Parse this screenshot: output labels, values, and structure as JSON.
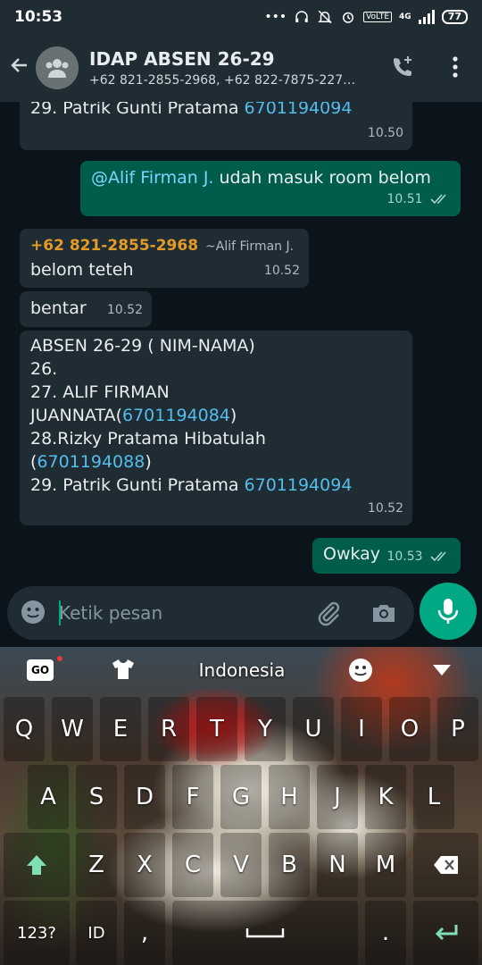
{
  "status_bar": {
    "time": "10:53",
    "network": "4G",
    "battery": "77"
  },
  "header": {
    "title": "IDAP ABSEN 26-29",
    "subtitle": "+62 821-2855-2968, +62 822-7875-227…"
  },
  "messages": {
    "m1": {
      "text_prefix": "29. Patrik Gunti Pratama ",
      "number": "6701194094",
      "time": "10.50"
    },
    "m2": {
      "mention": "@Alif Firman J.",
      "text": " udah masuk room belom",
      "time": "10.51"
    },
    "m3": {
      "sender": "+62 821-2855-2968",
      "sender_alias": "~Alif Firman J.",
      "text": "belom teteh",
      "time": "10.52"
    },
    "m4": {
      "text": "bentar",
      "time": "10.52"
    },
    "m5": {
      "line1": "ABSEN 26-29 ( NIM-NAMA)",
      "line2": "26.",
      "line3": "27. ALIF FIRMAN",
      "line4_prefix": "JUANNATA(",
      "line4_number": "6701194084",
      "line4_suffix": ")",
      "line5": "28.Rizky Pratama Hibatulah",
      "line6_prefix": "(",
      "line6_number": "6701194088",
      "line6_suffix": ")",
      "line7_prefix": "29. Patrik Gunti Pratama ",
      "line7_number": "6701194094",
      "time": "10.52"
    },
    "m6": {
      "text": "Owkay",
      "time": "10.53"
    }
  },
  "input": {
    "placeholder": "Ketik pesan"
  },
  "keyboard": {
    "go_label": "GO",
    "language": "Indonesia",
    "row1": [
      "Q",
      "W",
      "E",
      "R",
      "T",
      "Y",
      "U",
      "I",
      "O",
      "P"
    ],
    "row2": [
      "A",
      "S",
      "D",
      "F",
      "G",
      "H",
      "J",
      "K",
      "L"
    ],
    "row3": [
      "Z",
      "X",
      "C",
      "V",
      "B",
      "N",
      "M"
    ],
    "symbols_key": "123?",
    "lang_key": "ID",
    "comma_key": ",",
    "period_key": "."
  },
  "colors": {
    "accent": "#00a884",
    "outgoing_bubble": "#005c4b",
    "incoming_bubble": "#1f2c34",
    "link": "#53bdeb",
    "sender": "#e39b26"
  }
}
